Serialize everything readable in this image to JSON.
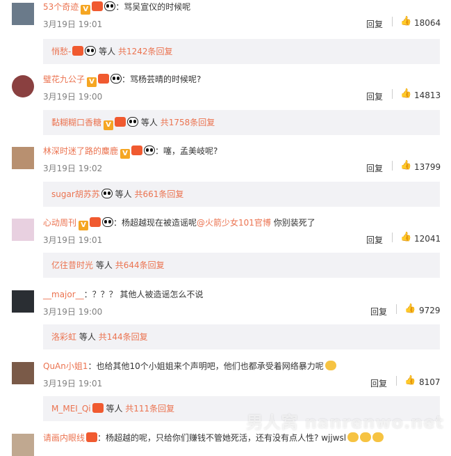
{
  "comments": [
    {
      "name": "53个奇迹",
      "text": "：骂吴宣仪的时候呢",
      "time": "3月19日 19:01",
      "reply": "回复",
      "likes": "18064",
      "sub": {
        "name": "悄愁-",
        "suffix": "等人",
        "count": "共1242条回复"
      }
    },
    {
      "name": "璧花九公子",
      "text": "：骂杨芸晴的时候呢?",
      "time": "3月19日 19:00",
      "reply": "回复",
      "likes": "14813",
      "sub": {
        "name": "黏糊糊口香糖",
        "suffix": "等人",
        "count": "共1758条回复"
      }
    },
    {
      "name": "林深时迷了路的麋鹿",
      "text": "：噻，孟美岐呢?",
      "time": "3月19日 19:02",
      "reply": "回复",
      "likes": "13799",
      "sub": {
        "name": "sugar胡苏苏",
        "suffix": "等人",
        "count": "共661条回复"
      }
    },
    {
      "name": "心动周刊",
      "text": "：杨超越现在被造谣呢",
      "mention": "@火箭少女101官博",
      "text2": " 你别装死了",
      "time": "3月19日 19:01",
      "reply": "回复",
      "likes": "12041",
      "sub": {
        "name": "亿往昔时光",
        "suffix": "等人",
        "count": "共644条回复"
      }
    },
    {
      "name": "__major__",
      "text": "：？？？ 其他人被造谣怎么不说",
      "time": "3月19日 19:00",
      "reply": "回复",
      "likes": "9729",
      "sub": {
        "name": "洛彩虹",
        "suffix": "等人",
        "count": "共144条回复"
      }
    },
    {
      "name": "QuAn小姐1",
      "text": "：也给其他10个小姐姐来个声明吧，他们也都承受着网络暴力呢",
      "time": "3月19日 19:01",
      "reply": "回复",
      "likes": "8107",
      "sub": {
        "name": "M_MEI_Qi",
        "suffix": "等人",
        "count": "共111条回复"
      }
    },
    {
      "name": "请画内眼线",
      "text": "：杨超越的呢，只给你们赚钱不管她死活，还有没有点人性? wjjwsl"
    }
  ],
  "watermark": "男人窝 nanrenwo.net",
  "colors": {
    "link": "#eb7350",
    "sub_bg": "#f2f2f5",
    "time": "#808080"
  }
}
